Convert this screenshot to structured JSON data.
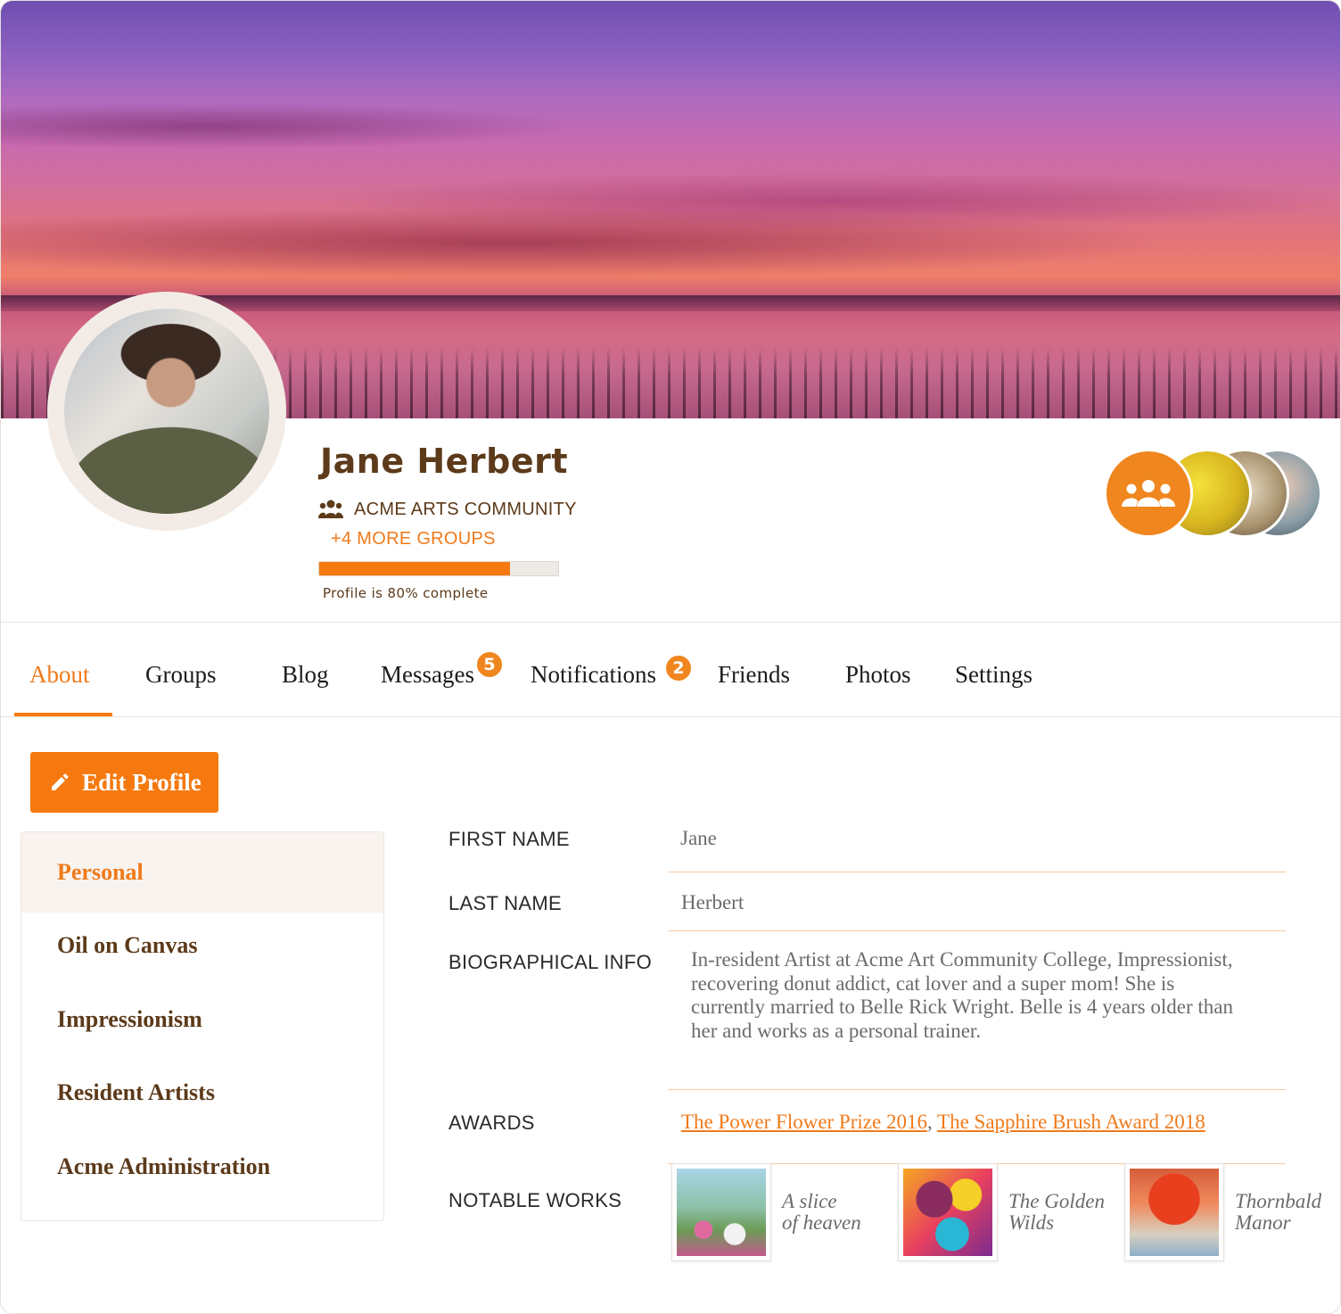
{
  "profile": {
    "name": "Jane Herbert",
    "primary_group": "ACME ARTS COMMUNITY",
    "more_groups": "+4 MORE GROUPS",
    "completion_percent": 80,
    "completion_text": "Profile is 80% complete"
  },
  "icons": {
    "group": "users-icon",
    "edit": "pencil-icon"
  },
  "colors": {
    "accent": "#f5790f",
    "heading": "#5c3a1a"
  },
  "tabs": [
    {
      "label": "About",
      "active": true
    },
    {
      "label": "Groups"
    },
    {
      "label": "Blog"
    },
    {
      "label": "Messages",
      "badge": "5"
    },
    {
      "label": "Notifications",
      "badge": "2"
    },
    {
      "label": "Friends"
    },
    {
      "label": "Photos"
    },
    {
      "label": "Settings"
    }
  ],
  "edit_button": {
    "label": "Edit Profile"
  },
  "side_menu": [
    {
      "label": "Personal",
      "active": true
    },
    {
      "label": "Oil on Canvas"
    },
    {
      "label": "Impressionism"
    },
    {
      "label": "Resident Artists"
    },
    {
      "label": "Acme Administration"
    }
  ],
  "fields": {
    "first_name": {
      "label": "FIRST NAME",
      "value": "Jane"
    },
    "last_name": {
      "label": "LAST NAME",
      "value": "Herbert"
    },
    "bio": {
      "label": "BIOGRAPHICAL INFO",
      "value": "In-resident Artist at Acme Art Community College, Impressionist, recovering donut addict, cat lover and a super mom! She is currently married to Belle Rick Wright. Belle is 4 years older than her and works as a personal trainer."
    },
    "awards": {
      "label": "AWARDS",
      "items": [
        "The Power Flower Prize 2016",
        "The Sapphire Brush Award 2018"
      ],
      "separator": ","
    },
    "notable_works": {
      "label": "NOTABLE WORKS",
      "items": [
        {
          "line1": "A slice",
          "line2": "of heaven"
        },
        {
          "line1": "The Golden",
          "line2": "Wilds"
        },
        {
          "line1": "Thornbald",
          "line2": "Manor"
        }
      ]
    }
  }
}
